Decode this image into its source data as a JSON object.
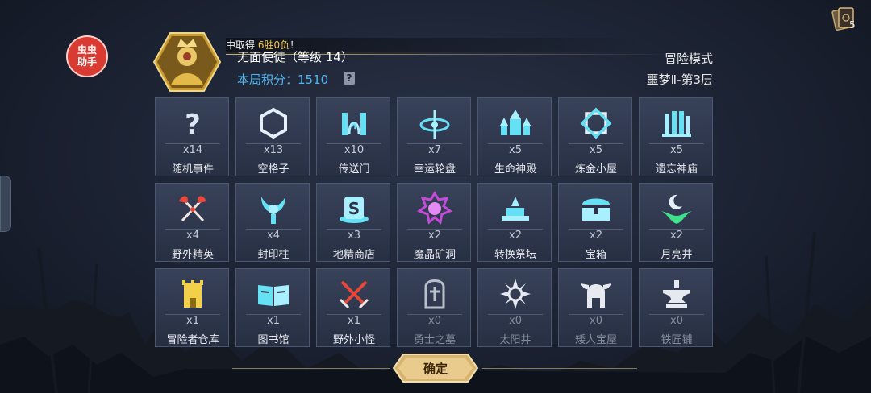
{
  "helper_badge": {
    "line1": "虫虫",
    "line2": "助手"
  },
  "card_count": "5",
  "header": {
    "toast_prefix": "中取得 ",
    "toast_highlight": "6胜0负",
    "toast_suffix": "！",
    "player_name": "无面使徒（等级 14）",
    "score_label": "本局积分：",
    "score_value": "1510",
    "help_icon": "?",
    "mode": "冒险模式",
    "floor": "噩梦Ⅱ-第3层"
  },
  "colors": {
    "accent_blue": "#4fb6f2",
    "gold": "#d4b878",
    "panel": "#36405a",
    "purple": "#c34bd8",
    "red": "#e6483b",
    "green": "#3fe08a"
  },
  "rooms": [
    {
      "icon": "question-icon",
      "count": "x14",
      "label": "随机事件"
    },
    {
      "icon": "hexagon-icon",
      "count": "x13",
      "label": "空格子"
    },
    {
      "icon": "portal-icon",
      "count": "x10",
      "label": "传送门"
    },
    {
      "icon": "wheel-icon",
      "count": "x7",
      "label": "幸运轮盘"
    },
    {
      "icon": "temple-icon",
      "count": "x5",
      "label": "生命神殿"
    },
    {
      "icon": "alchemy-icon",
      "count": "x5",
      "label": "炼金小屋"
    },
    {
      "icon": "ruins-icon",
      "count": "x5",
      "label": "遗忘神庙"
    },
    {
      "icon": "crossed-axes-icon",
      "count": "x4",
      "label": "野外精英"
    },
    {
      "icon": "seal-pillar-icon",
      "count": "x4",
      "label": "封印柱"
    },
    {
      "icon": "goblin-shop-icon",
      "count": "x3",
      "label": "地精商店"
    },
    {
      "icon": "crystal-mine-icon",
      "count": "x2",
      "label": "魔晶矿洞"
    },
    {
      "icon": "altar-icon",
      "count": "x2",
      "label": "转换祭坛"
    },
    {
      "icon": "chest-icon",
      "count": "x2",
      "label": "宝箱"
    },
    {
      "icon": "moon-well-icon",
      "count": "x2",
      "label": "月亮井"
    },
    {
      "icon": "warehouse-icon",
      "count": "x1",
      "label": "冒险者仓库"
    },
    {
      "icon": "book-icon",
      "count": "x1",
      "label": "图书馆"
    },
    {
      "icon": "crossed-swords-icon",
      "count": "x1",
      "label": "野外小怪"
    },
    {
      "icon": "tomb-icon",
      "count": "x0",
      "label": "勇士之墓"
    },
    {
      "icon": "sun-well-icon",
      "count": "x0",
      "label": "太阳井"
    },
    {
      "icon": "dwarf-helm-icon",
      "count": "x0",
      "label": "矮人宝屋"
    },
    {
      "icon": "anvil-icon",
      "count": "x0",
      "label": "铁匠铺"
    }
  ],
  "confirm_label": "确定"
}
